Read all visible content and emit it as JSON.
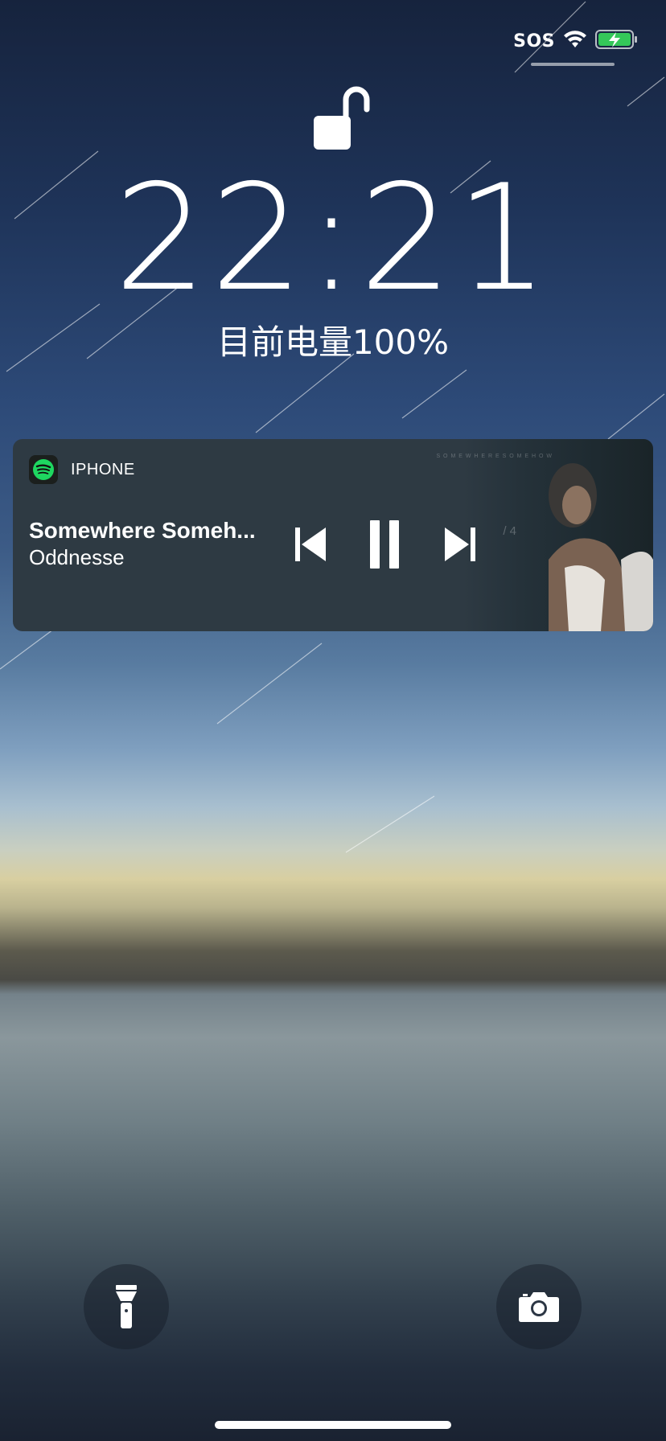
{
  "status_bar": {
    "carrier": "SOS",
    "wifi_icon": "wifi-icon",
    "battery_icon": "battery-charging-icon",
    "battery_color": "#34c759"
  },
  "lock_screen": {
    "lock_icon": "unlocked-padlock-icon",
    "time": "22:21",
    "battery_status": "目前电量100%"
  },
  "now_playing": {
    "app_name": "IPHONE",
    "app_icon": "spotify-icon",
    "app_color": "#1ed760",
    "title": "Somewhere Someh...",
    "artist": "Oddnesse",
    "album_text": "S O M E W H E R E   S O M E H O W",
    "album_track": "/ 4",
    "controls": {
      "previous": "previous-track-icon",
      "pause": "pause-icon",
      "next": "next-track-icon"
    }
  },
  "quick_actions": {
    "flashlight": "flashlight-icon",
    "camera": "camera-icon"
  }
}
